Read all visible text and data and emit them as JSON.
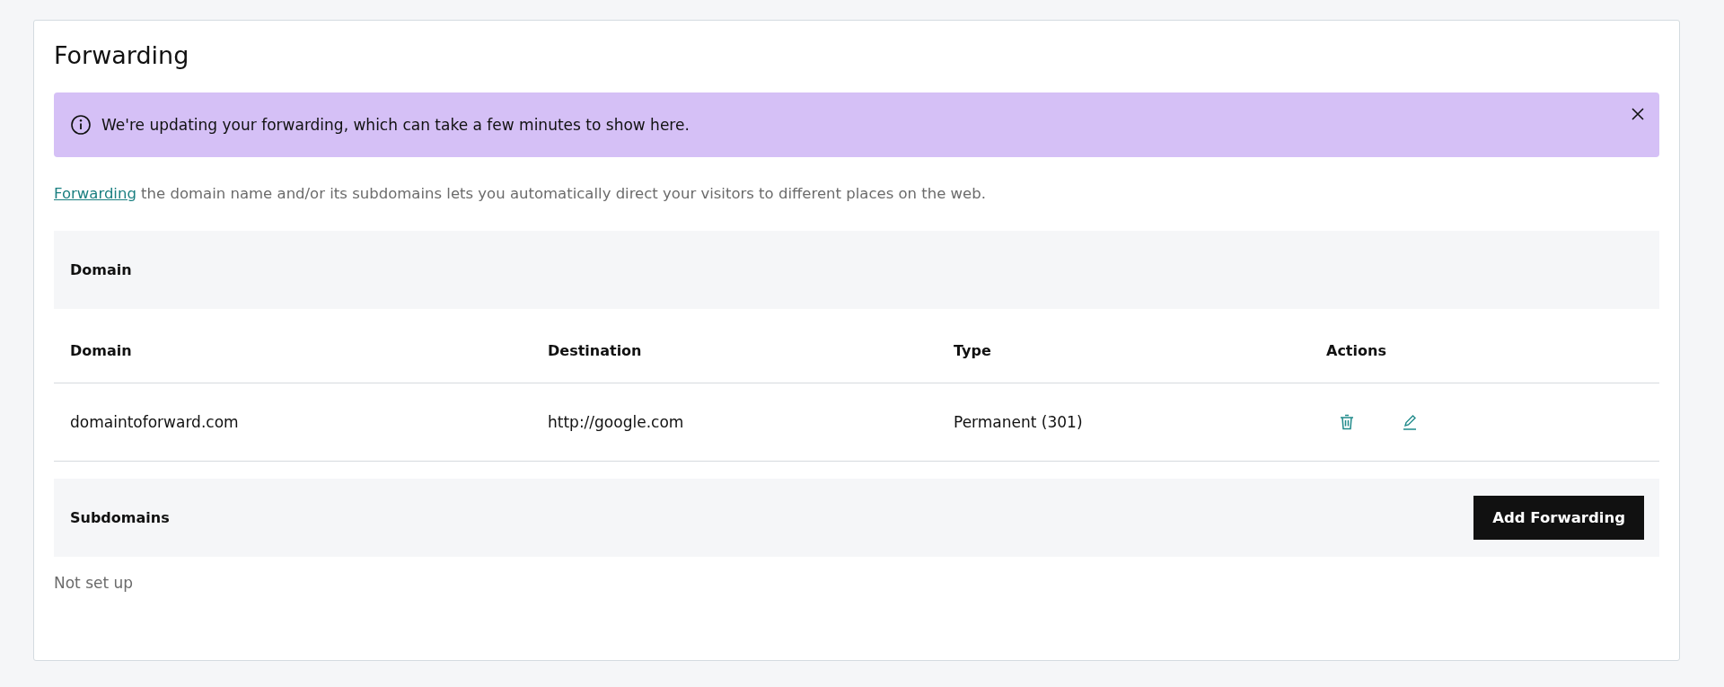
{
  "title": "Forwarding",
  "banner": {
    "message": "We're updating your forwarding, which can take a few minutes to show here."
  },
  "description": {
    "link": "Forwarding",
    "text": " the domain name and/or its subdomains lets you automatically direct your visitors to different places on the web."
  },
  "domain_section": {
    "title": "Domain"
  },
  "table": {
    "columns": [
      "Domain",
      "Destination",
      "Type",
      "Actions"
    ],
    "rows": [
      {
        "domain": "domaintoforward.com",
        "destination": "http://google.com",
        "type": "Permanent (301)"
      }
    ]
  },
  "subdomains_section": {
    "title": "Subdomains",
    "button": "Add Forwarding",
    "empty_text": "Not set up"
  }
}
